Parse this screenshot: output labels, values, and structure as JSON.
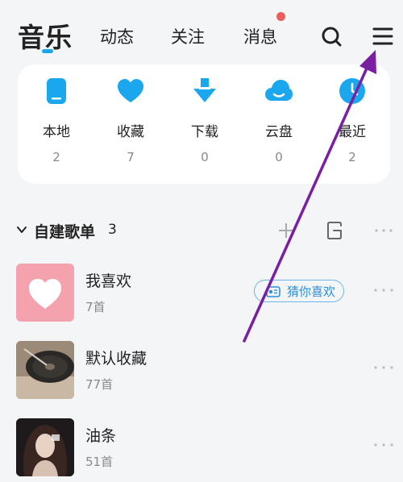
{
  "nav": {
    "tabs": [
      {
        "label": "音乐"
      },
      {
        "label": "动态"
      },
      {
        "label": "关注"
      },
      {
        "label": "消息"
      }
    ]
  },
  "quick": {
    "items": [
      {
        "label": "本地",
        "count": "2",
        "icon": "phone-icon"
      },
      {
        "label": "收藏",
        "count": "7",
        "icon": "heart-icon"
      },
      {
        "label": "下载",
        "count": "0",
        "icon": "download-icon"
      },
      {
        "label": "云盘",
        "count": "0",
        "icon": "cloud-icon"
      },
      {
        "label": "最近",
        "count": "2",
        "icon": "clock-icon"
      }
    ]
  },
  "playlists_section": {
    "title": "自建歌单",
    "count": "3"
  },
  "playlists": [
    {
      "name": "我喜欢",
      "sub": "7首",
      "cover": "heart-cover"
    },
    {
      "name": "默认收藏",
      "sub": "77首",
      "cover": "vinyl-cover"
    },
    {
      "name": "油条",
      "sub": "51首",
      "cover": "portrait-cover"
    }
  ],
  "guess_like": {
    "label": "猜你喜欢"
  },
  "colors": {
    "accent": "#1aa7ee",
    "badge": "#f05b5b",
    "annotation_arrow": "#7b1fa2",
    "heart_cover": "#f4a2ad"
  }
}
